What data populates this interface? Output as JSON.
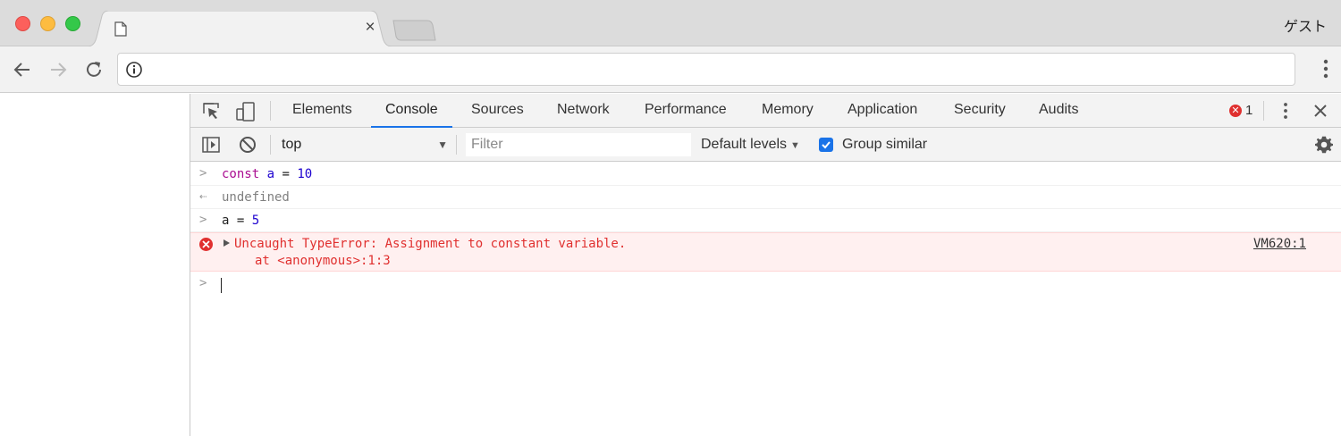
{
  "window": {
    "profile_label": "ゲスト",
    "tab": {
      "close_glyph": "×",
      "icon": "page-icon"
    }
  },
  "toolbar": {
    "back_icon": "arrow-left-icon",
    "forward_icon": "arrow-right-icon",
    "reload_icon": "reload-icon",
    "omnibox_icon": "info-icon",
    "menu_icon": "vertical-dots-icon"
  },
  "devtools": {
    "tabs": [
      {
        "label": "Elements"
      },
      {
        "label": "Console",
        "active": true
      },
      {
        "label": "Sources"
      },
      {
        "label": "Network"
      },
      {
        "label": "Performance"
      },
      {
        "label": "Memory"
      },
      {
        "label": "Application"
      },
      {
        "label": "Security"
      },
      {
        "label": "Audits"
      }
    ],
    "error_count": "1",
    "console_bar": {
      "context": "top",
      "filter_placeholder": "Filter",
      "levels": "Default levels",
      "group_similar": "Group similar",
      "group_similar_checked": true
    },
    "console": {
      "lines": [
        {
          "type": "input",
          "keyword": "const",
          "variable": "a",
          "operator": " = ",
          "value": "10"
        },
        {
          "type": "result",
          "text": "undefined"
        },
        {
          "type": "input",
          "variable": "a",
          "operator": " = ",
          "value": "5"
        },
        {
          "type": "error",
          "message": "Uncaught TypeError: Assignment to constant variable.",
          "stack": "at <anonymous>:1:3",
          "source": "VM620:1"
        }
      ]
    }
  },
  "colors": {
    "accent": "#1a73e8",
    "error": "#e0302f",
    "keyword": "#aa0d91",
    "number": "#1c00cf"
  }
}
